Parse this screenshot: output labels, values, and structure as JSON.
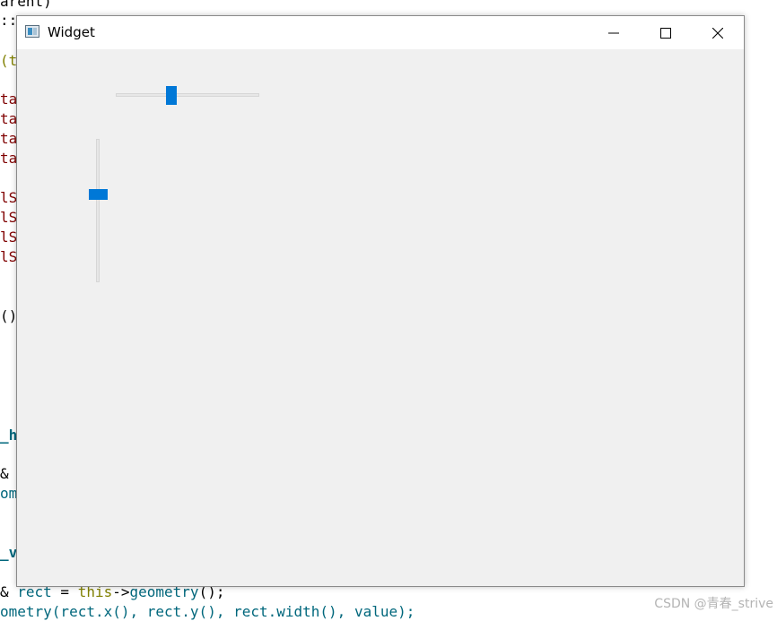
{
  "code_fragments": [
    {
      "text": "arent)",
      "cls": "c-dark"
    },
    {
      "text": "::",
      "cls": "c-dark"
    },
    {
      "text": "(t",
      "cls": "c-olive"
    },
    {
      "text": "ta",
      "cls": "c-red"
    },
    {
      "text": "ta",
      "cls": "c-red"
    },
    {
      "text": "ta",
      "cls": "c-red"
    },
    {
      "text": "ta",
      "cls": "c-red"
    },
    {
      "text": "lS",
      "cls": "c-red"
    },
    {
      "text": "lS",
      "cls": "c-red"
    },
    {
      "text": "lS",
      "cls": "c-red"
    },
    {
      "text": "lS",
      "cls": "c-red"
    },
    {
      "text": "()",
      "cls": "c-dark"
    },
    {
      "text": "_h",
      "cls": "c-teal c-bold"
    },
    {
      "text": "&",
      "cls": "c-dark"
    },
    {
      "text": "om",
      "cls": "c-teal"
    },
    {
      "text": "_v",
      "cls": "c-teal c-bold"
    }
  ],
  "code_line_full_1": {
    "prefix": "& ",
    "var": "rect",
    "eq": " = ",
    "kw": "this",
    "arrow": "->",
    "fn": "geometry",
    "suffix": "();"
  },
  "code_line_full_2": "ometry(rect.x(), rect.y(), rect.width(), value);",
  "window": {
    "title": "Widget",
    "buttons": {
      "minimize": "minimize-icon",
      "maximize": "maximize-icon",
      "close": "close-icon"
    }
  },
  "sliders": {
    "horizontal": {
      "value_fraction": 0.38
    },
    "vertical": {
      "value_fraction": 0.38
    }
  },
  "colors": {
    "accent": "#0078d7",
    "window_bg": "#f0f0f0",
    "titlebar_bg": "#ffffff"
  },
  "watermark": "CSDN @青春_strive"
}
